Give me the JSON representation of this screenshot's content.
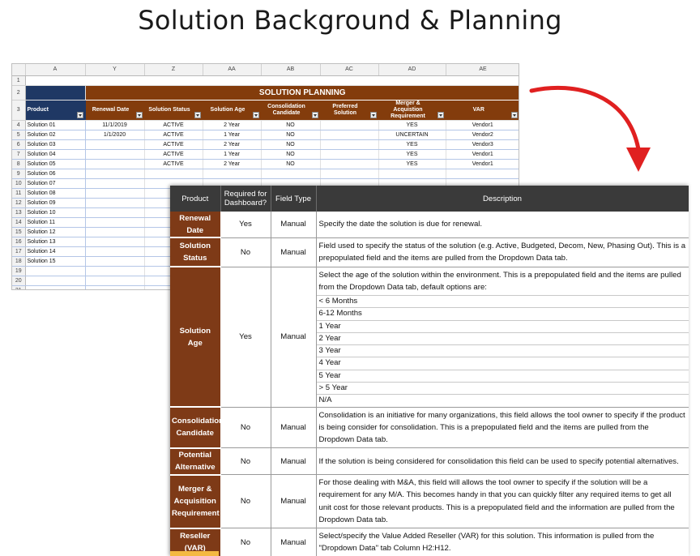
{
  "page": {
    "title": "Solution Background & Planning"
  },
  "sheet": {
    "col_letters": [
      "A",
      "Y",
      "Z",
      "AA",
      "AB",
      "AC",
      "AD",
      "AE"
    ],
    "row_numbers": [
      "1",
      "2",
      "3",
      "4",
      "5",
      "6",
      "7",
      "8",
      "9",
      "10",
      "11",
      "12",
      "13",
      "14",
      "15",
      "16",
      "17",
      "18",
      "19",
      "20",
      "21"
    ],
    "planning_title": "SOLUTION PLANNING",
    "headers": [
      "Product",
      "Renewal Date",
      "Solution Status",
      "Solution Age",
      "Consolidation Candidate",
      "Preferred Solution",
      "Merger & Acquistion Requirement",
      "VAR"
    ],
    "rows": [
      [
        "Solution 01",
        "11/1/2019",
        "ACTIVE",
        "2 Year",
        "NO",
        "",
        "YES",
        "Vendor1"
      ],
      [
        "Solution 02",
        "1/1/2020",
        "ACTIVE",
        "1 Year",
        "NO",
        "",
        "UNCERTAIN",
        "Vendor2"
      ],
      [
        "Solution 03",
        "",
        "ACTIVE",
        "2 Year",
        "NO",
        "",
        "YES",
        "Vendor3"
      ],
      [
        "Solution 04",
        "",
        "ACTIVE",
        "1 Year",
        "NO",
        "",
        "YES",
        "Vendor1"
      ],
      [
        "Solution 05",
        "",
        "ACTIVE",
        "2 Year",
        "NO",
        "",
        "YES",
        "Vendor1"
      ],
      [
        "Solution 06",
        "",
        "",
        "",
        "",
        "",
        "",
        ""
      ],
      [
        "Solution 07",
        "",
        "",
        "",
        "",
        "",
        "",
        ""
      ],
      [
        "Solution 08",
        "",
        "",
        "",
        "",
        "",
        "",
        ""
      ],
      [
        "Solution 09",
        "",
        "",
        "",
        "",
        "",
        "",
        ""
      ],
      [
        "Solution 10",
        "",
        "",
        "",
        "",
        "",
        "",
        ""
      ],
      [
        "Solution 11",
        "",
        "",
        "",
        "",
        "",
        "",
        ""
      ],
      [
        "Solution 12",
        "",
        "",
        "",
        "",
        "",
        "",
        ""
      ],
      [
        "Solution 13",
        "",
        "",
        "",
        "",
        "",
        "",
        ""
      ],
      [
        "Solution 14",
        "",
        "",
        "",
        "",
        "",
        "",
        ""
      ],
      [
        "Solution 15",
        "",
        "",
        "",
        "",
        "",
        "",
        ""
      ]
    ]
  },
  "arrow": {
    "color": "#e02020",
    "icon": "curved-arrow-icon"
  },
  "desc": {
    "headers": [
      "Product",
      "Required for Dashboard?",
      "Field Type",
      "Description"
    ],
    "rows": [
      {
        "product": "Renewal Date",
        "required": "Yes",
        "field_type": "Manual",
        "description": "Specify the date the solution is due for renewal."
      },
      {
        "product": "Solution Status",
        "required": "No",
        "field_type": "Manual",
        "description": "Field used to specify the status of the solution (e.g. Active, Budgeted, Decom, New, Phasing Out).  This is a prepopulated field and the items are pulled from the Dropdown Data tab."
      },
      {
        "product": "Solution Age",
        "required": "Yes",
        "field_type": "Manual",
        "description": "Select the age of the solution within the environment.  This is a prepopulated field and the items are pulled from the Dropdown Data tab, default options are:",
        "options": [
          "< 6 Months",
          "6-12 Months",
          "1 Year",
          "2 Year",
          "3 Year",
          "4 Year",
          "5 Year",
          "> 5 Year",
          "N/A"
        ]
      },
      {
        "product": "Consolidation Candidate",
        "required": "No",
        "field_type": "Manual",
        "description": "Consolidation is an initiative for many organizations, this field allows the tool owner to specify if the product is being consider for consolidation.  This is a prepopulated field and the items are pulled from the Dropdown Data tab."
      },
      {
        "product": "Potential Alternative",
        "required": "No",
        "field_type": "Manual",
        "description": "If the solution is being considered for consolidation this field can be used to specify potential alternatives."
      },
      {
        "product": "Merger & Acquisition Requirement",
        "required": "No",
        "field_type": "Manual",
        "description": "For those dealing with M&A, this field will allows the tool owner to specify if the solution will be a requirement for any M/A.  This becomes handy in that you can quickly filter any required items to get all unit cost for those relevant products.  This is a prepopulated field and the information are pulled from the Dropdown Data tab."
      },
      {
        "product": "Reseller (VAR)",
        "required": "No",
        "field_type": "Manual",
        "description": "Select/specify the Value Added Reseller (VAR) for this solution.  This information is pulled from the \"Dropdown Data\" tab Column H2:H12."
      }
    ]
  }
}
